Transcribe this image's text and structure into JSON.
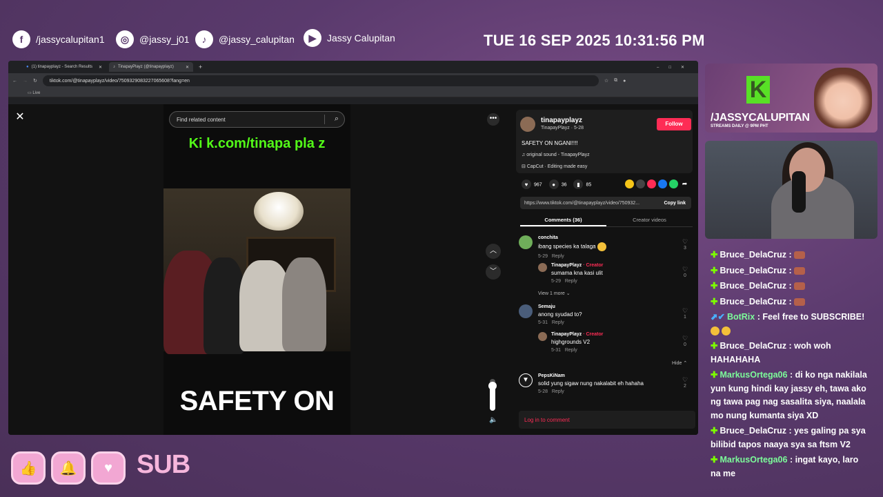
{
  "socials": {
    "facebook": "/jassycalupitan1",
    "instagram": "@jassy_j01",
    "tiktok": "@jassy_calupitan",
    "youtube": "Jassy Calupitan"
  },
  "clock": "TUE 16 SEP 2025 10:31:56 PM",
  "browser": {
    "tab1": "(1) tinapayplayz - Search Results",
    "tab2": "TinapayPlayz (@tinapayplayz)",
    "url": "tiktok.com/@tinapayplayz/video/7509329083227065608?lang=en",
    "bookmark": "Live"
  },
  "video": {
    "search_placeholder": "Find related content",
    "kick_text": "Ki k.com/tinapa pla z",
    "caption": "SAFETY ON"
  },
  "post": {
    "username": "tinapayplayz",
    "sub": "TinapayPlayz · 5-28",
    "follow": "Follow",
    "description": "SAFETY ON NGANI!!!!",
    "sound": "original sound - TinapayPlayz",
    "capcut": "CapCut · Editing made easy",
    "likes": "967",
    "comments": "36",
    "saves": "85",
    "link": "https://www.tiktok.com/@tinapayplayz/video/750932...",
    "copy": "Copy link",
    "tab_comments": "Comments (36)",
    "tab_creator": "Creator videos",
    "login": "Log in to comment"
  },
  "comments": [
    {
      "name": "conchita",
      "text": "ibang species ka talaga",
      "date": "5-29",
      "reply": "Reply",
      "likes": "3"
    },
    {
      "name": "TinapayPlayz",
      "tag": "· Creator",
      "text": "sumama kna kasi ulit",
      "date": "5-29",
      "reply": "Reply",
      "likes": "0"
    },
    {
      "name": "Semaju",
      "text": "anong syudad to?",
      "date": "5-31",
      "reply": "Reply",
      "likes": "1"
    },
    {
      "name": "TinapayPlayz",
      "tag": "· Creator",
      "text": "highgrounds V2",
      "date": "5-31",
      "reply": "Reply",
      "likes": "0"
    },
    {
      "name": "PepsKiNam",
      "text": "solid yung sigaw nung nakalabit eh hahaha",
      "date": "5-28",
      "reply": "Reply",
      "likes": "2"
    }
  ],
  "view_more": "View 1 more",
  "hide": "Hide",
  "volume_level": 0.78,
  "brand": {
    "handle": "/JASSYCALUPITAN",
    "schedule": "STREAMS DAILY @ 9PM PHT"
  },
  "chat": [
    {
      "user": "Bruce_DelaCruz",
      "msg": ":"
    },
    {
      "user": "Bruce_DelaCruz",
      "msg": ":"
    },
    {
      "user": "Bruce_DelaCruz",
      "msg": ":"
    },
    {
      "user": "Bruce_DelaCruz",
      "msg": ":"
    },
    {
      "user": "BotRix",
      "msg": ": Feel free to SUBSCRIBE!"
    },
    {
      "user": "Bruce_DelaCruz",
      "msg": ": woh woh HAHAHAHA"
    },
    {
      "user": "MarkusOrtega06",
      "msg": ": di ko nga nakilala yun kung hindi kay jassy eh, tawa ako ng tawa pag nag sasalita siya, naalala mo nung kumanta siya XD"
    },
    {
      "user": "Bruce_DelaCruz",
      "msg": ": yes galing pa sya bilibid tapos naaya sya sa ftsm V2"
    },
    {
      "user": "MarkusOrtega06",
      "msg": ": ingat kayo, laro na me"
    }
  ],
  "bottom": {
    "sub": "SUB"
  },
  "colors": {
    "tiktok_red": "#fe2c55",
    "kick_green": "#53fc18",
    "bg_purple": "#5a3a6d"
  }
}
